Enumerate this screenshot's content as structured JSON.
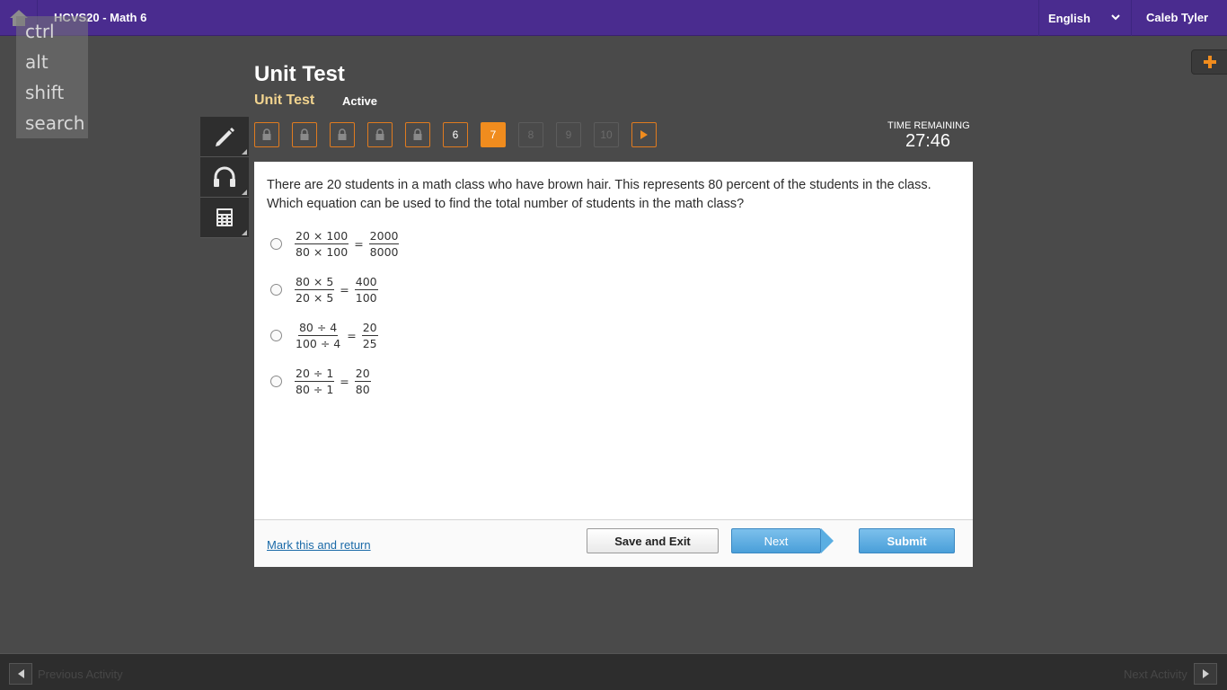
{
  "header": {
    "course_title": "HCVS20 - Math 6",
    "language": "English",
    "user_name": "Caleb Tyler"
  },
  "key_overlay": [
    "ctrl",
    "alt",
    "shift",
    "search"
  ],
  "activity": {
    "title": "Unit Test",
    "subtitle": "Unit Test",
    "status": "Active"
  },
  "tools": [
    {
      "icon": "pencil-icon"
    },
    {
      "icon": "headphones-icon"
    },
    {
      "icon": "calculator-icon"
    }
  ],
  "question_nav": {
    "items": [
      {
        "label": "",
        "state": "locked"
      },
      {
        "label": "",
        "state": "locked"
      },
      {
        "label": "",
        "state": "locked"
      },
      {
        "label": "",
        "state": "locked"
      },
      {
        "label": "",
        "state": "locked"
      },
      {
        "label": "6",
        "state": "answered"
      },
      {
        "label": "7",
        "state": "current"
      },
      {
        "label": "8",
        "state": "disabled"
      },
      {
        "label": "9",
        "state": "disabled"
      },
      {
        "label": "10",
        "state": "disabled"
      }
    ]
  },
  "timer": {
    "label": "TIME REMAINING",
    "value": "27:46"
  },
  "question": {
    "text_line1": "There are 20 students in a math class who have brown hair. This represents 80 percent of the students in the class.",
    "text_line2": "Which equation can be used to find the total number of students in the math class?",
    "options": [
      {
        "lhs_num": "20 × 100",
        "lhs_den": "80 × 100",
        "eq": "=",
        "rhs_num": "2000",
        "rhs_den": "8000"
      },
      {
        "lhs_num": "80 × 5",
        "lhs_den": "20 × 5",
        "eq": "=",
        "rhs_num": "400",
        "rhs_den": "100"
      },
      {
        "lhs_num": "80 ÷ 4",
        "lhs_den": "100 ÷ 4",
        "eq": "=",
        "rhs_num": "20",
        "rhs_den": "25"
      },
      {
        "lhs_num": "20 ÷ 1",
        "lhs_den": "80 ÷ 1",
        "eq": "=",
        "rhs_num": "20",
        "rhs_den": "80"
      }
    ]
  },
  "footer": {
    "mark_link": "Mark this and return",
    "save_label": "Save and Exit",
    "next_label": "Next",
    "submit_label": "Submit"
  },
  "bottom_bar": {
    "prev_label": "Previous Activity",
    "next_label": "Next Activity"
  },
  "colors": {
    "header_bg": "#4a2c8f",
    "accent_orange": "#f08c1e",
    "subtitle_gold": "#f2d48f",
    "button_blue": "#4a9fd9"
  }
}
